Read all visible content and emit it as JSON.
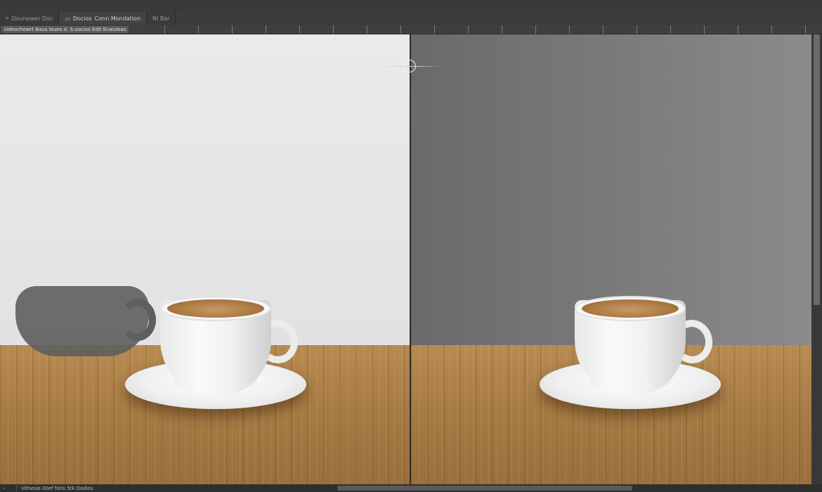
{
  "tabs": [
    {
      "label": "Dounewer Doc",
      "icon": "search-icon",
      "active": false
    },
    {
      "label": "Docios",
      "icon": "document-icon",
      "active": true
    },
    {
      "label": "Conn Mondation",
      "icon": "",
      "active": true
    },
    {
      "label": "Ni Bar",
      "icon": "",
      "active": false
    }
  ],
  "options": {
    "path_chip": "Udeochewrt Baus leues d. S:uocios Edit Ecwuleas"
  },
  "status": {
    "left_label": "Vithesie 00ef fotis 5tk Dodios"
  },
  "colors": {
    "ui_dark": "#2b2b2b",
    "panel_left_bg": "#e6e6e6",
    "panel_right_bg": "#7a7a7a",
    "wood": "#a67a44"
  }
}
